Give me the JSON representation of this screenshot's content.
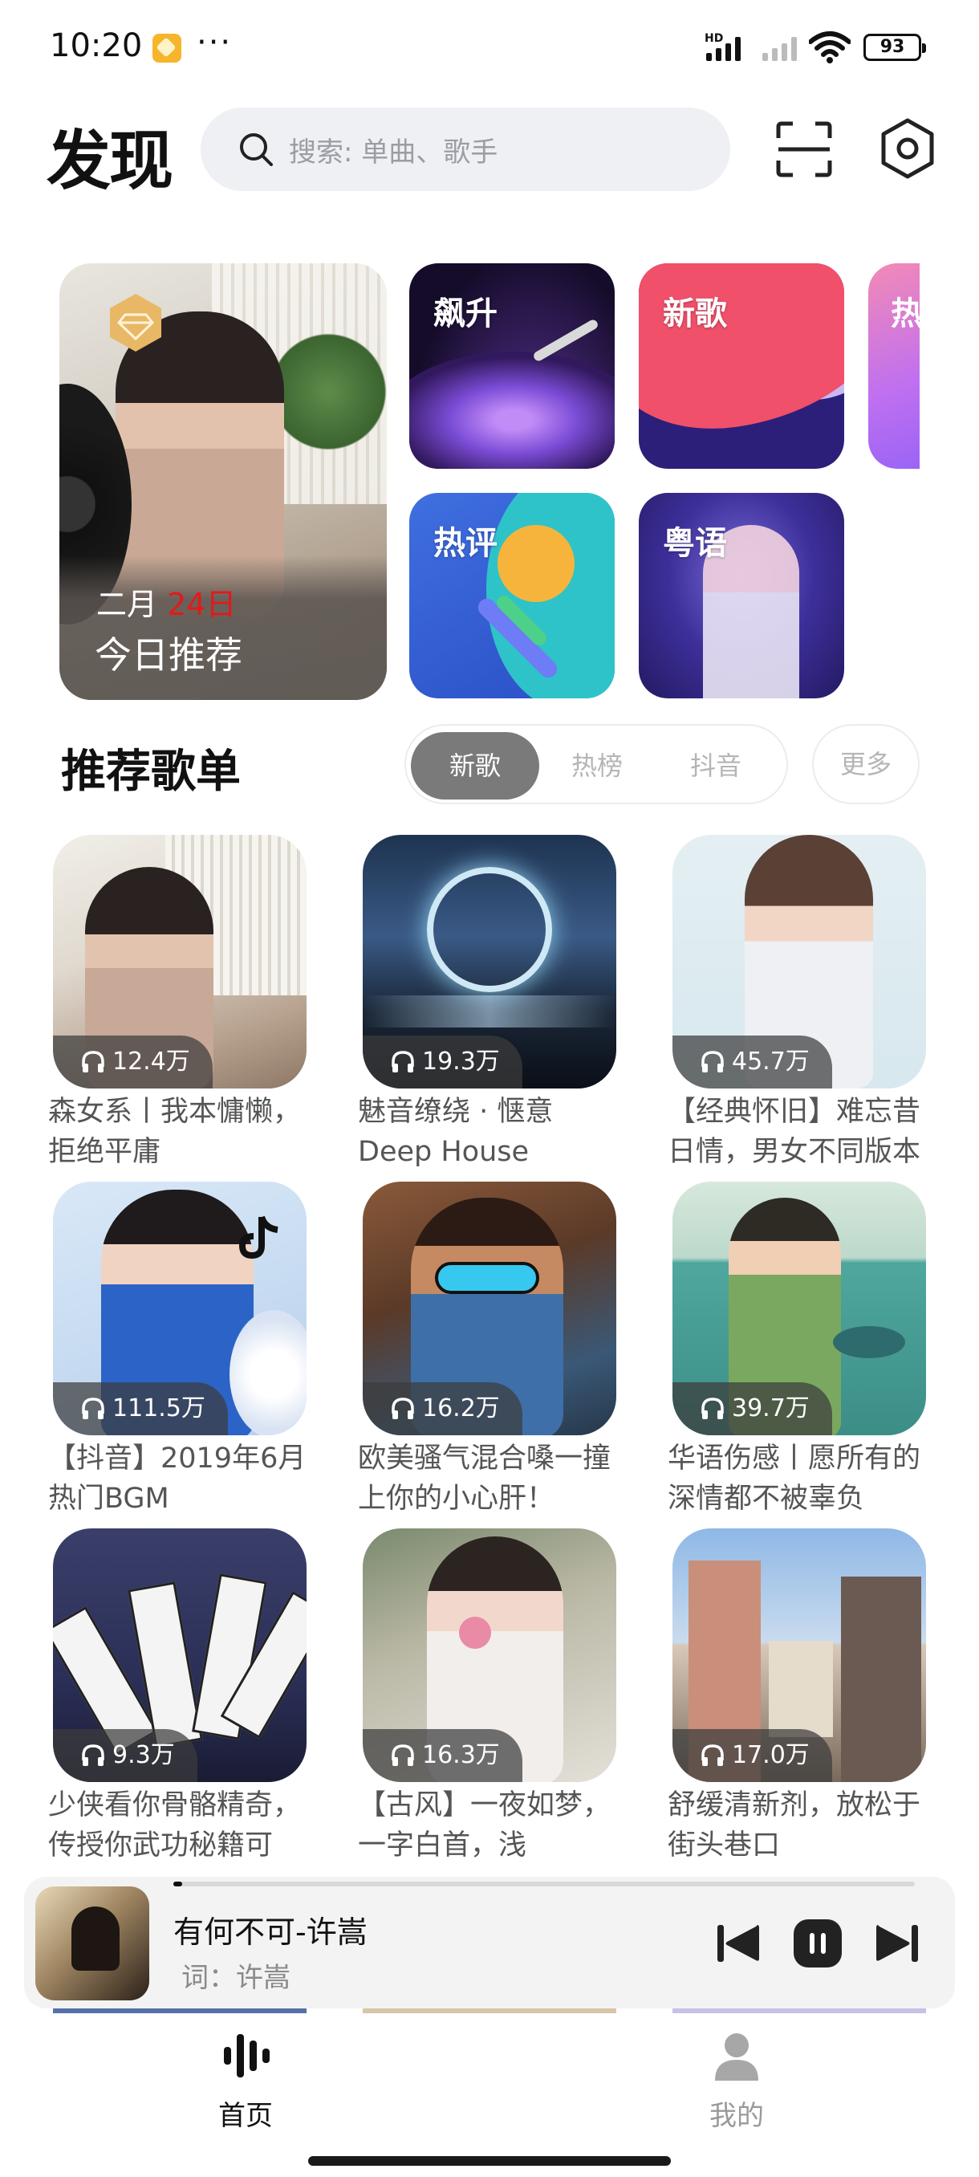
{
  "status_bar": {
    "time": "10:20",
    "dots": "···",
    "hd": "HD",
    "battery": "93"
  },
  "header": {
    "title": "发现",
    "search_placeholder": "搜索: 单曲、歌手"
  },
  "hero": {
    "date_prefix": "二月 ",
    "date_day": "24日",
    "title": "今日推荐"
  },
  "tiles": [
    {
      "label": "飙升"
    },
    {
      "label": "新歌"
    },
    {
      "label": "热评"
    },
    {
      "label": "粤语"
    },
    {
      "label": "热"
    }
  ],
  "recommend": {
    "title": "推荐歌单",
    "tabs": [
      "新歌",
      "热榜",
      "抖音"
    ],
    "active_tab": "新歌",
    "more": "更多"
  },
  "playlists": [
    {
      "plays": "12.4万",
      "title": "森女系丨我本慵懒，拒绝平庸"
    },
    {
      "plays": "19.3万",
      "title": "魅音缭绕 · 惬意 Deep House"
    },
    {
      "plays": "45.7万",
      "title": "【经典怀旧】难忘昔日情，男女不同版本"
    },
    {
      "plays": "111.5万",
      "title": "【抖音】2019年6月热门BGM"
    },
    {
      "plays": "16.2万",
      "title": "欧美骚气混合嗓一撞上你的小心肝！"
    },
    {
      "plays": "39.7万",
      "title": "华语伤感丨愿所有的深情都不被辜负"
    },
    {
      "plays": "9.3万",
      "title": "少侠看你骨骼精奇，传授你武功秘籍可"
    },
    {
      "plays": "16.3万",
      "title": "【古风】一夜如梦，一字白首，浅"
    },
    {
      "plays": "17.0万",
      "title": "舒缓清新剂，放松于街头巷口"
    }
  ],
  "player": {
    "title": "有何不可-许嵩",
    "lyric": "词：许嵩",
    "progress": 0.01
  },
  "nav": {
    "home": "首页",
    "mine": "我的"
  },
  "colors": {
    "accent_red": "#e11a1a",
    "active_tab_bg": "#7a7a7a"
  }
}
